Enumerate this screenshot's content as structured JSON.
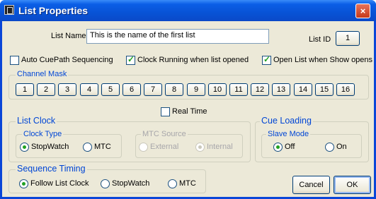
{
  "window": {
    "title": "List Properties",
    "close_label": "×"
  },
  "list_name": {
    "label": "List Name",
    "value": "This is the name of the first list"
  },
  "list_id": {
    "label": "List ID",
    "value": "1"
  },
  "options": {
    "auto_cuepath": {
      "label": "Auto CuePath Sequencing",
      "checked": false
    },
    "clock_running": {
      "label": "Clock Running when list opened",
      "checked": true
    },
    "open_list": {
      "label": "Open List when Show opens",
      "checked": true
    }
  },
  "channel_mask": {
    "label": "Channel Mask",
    "channels": [
      "1",
      "2",
      "3",
      "4",
      "5",
      "6",
      "7",
      "8",
      "9",
      "10",
      "11",
      "12",
      "13",
      "14",
      "15",
      "16"
    ]
  },
  "real_time": {
    "label": "Real Time",
    "checked": false
  },
  "list_clock": {
    "label": "List Clock",
    "clock_type": {
      "label": "Clock Type",
      "options": [
        "StopWatch",
        "MTC"
      ],
      "selected": "StopWatch"
    },
    "mtc_source": {
      "label": "MTC Source",
      "options": [
        "External",
        "Internal"
      ],
      "selected": "Internal",
      "disabled": true
    }
  },
  "cue_loading": {
    "label": "Cue Loading",
    "slave_mode": {
      "label": "Slave Mode",
      "options": [
        "Off",
        "On"
      ],
      "selected": "Off"
    }
  },
  "sequence_timing": {
    "label": "Sequence Timing",
    "options": [
      "Follow List Clock",
      "StopWatch",
      "MTC"
    ],
    "selected": "Follow List Clock"
  },
  "buttons": {
    "cancel": "Cancel",
    "ok": "OK"
  }
}
